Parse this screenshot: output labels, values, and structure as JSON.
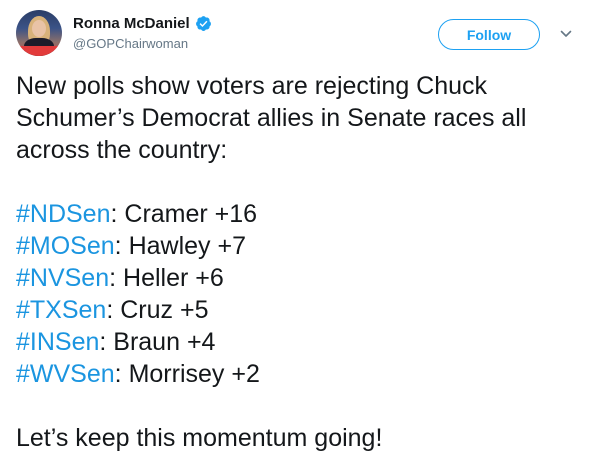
{
  "author": {
    "display_name": "Ronna McDaniel",
    "handle": "@GOPChairwoman",
    "verified": true
  },
  "actions": {
    "follow_label": "Follow",
    "menu_icon": "chevron-down-icon"
  },
  "colors": {
    "link": "#1b95e0",
    "follow_border": "#1da1f2",
    "text": "#14171a",
    "secondary": "#657786"
  },
  "tweet": {
    "intro_lines": [
      "New polls show voters are rejecting Chuck",
      "Schumer’s Democrat allies in Senate races all",
      "across the country:"
    ],
    "races": [
      {
        "hashtag": "#NDSen",
        "text": ": Cramer +16"
      },
      {
        "hashtag": "#MOSen",
        "text": ": Hawley +7"
      },
      {
        "hashtag": "#NVSen",
        "text": ": Heller +6"
      },
      {
        "hashtag": "#TXSen",
        "text": ": Cruz +5"
      },
      {
        "hashtag": "#INSen",
        "text": ": Braun +4"
      },
      {
        "hashtag": "#WVSen",
        "text": ": Morrisey +2"
      }
    ],
    "closing": "Let’s keep this momentum going!"
  }
}
